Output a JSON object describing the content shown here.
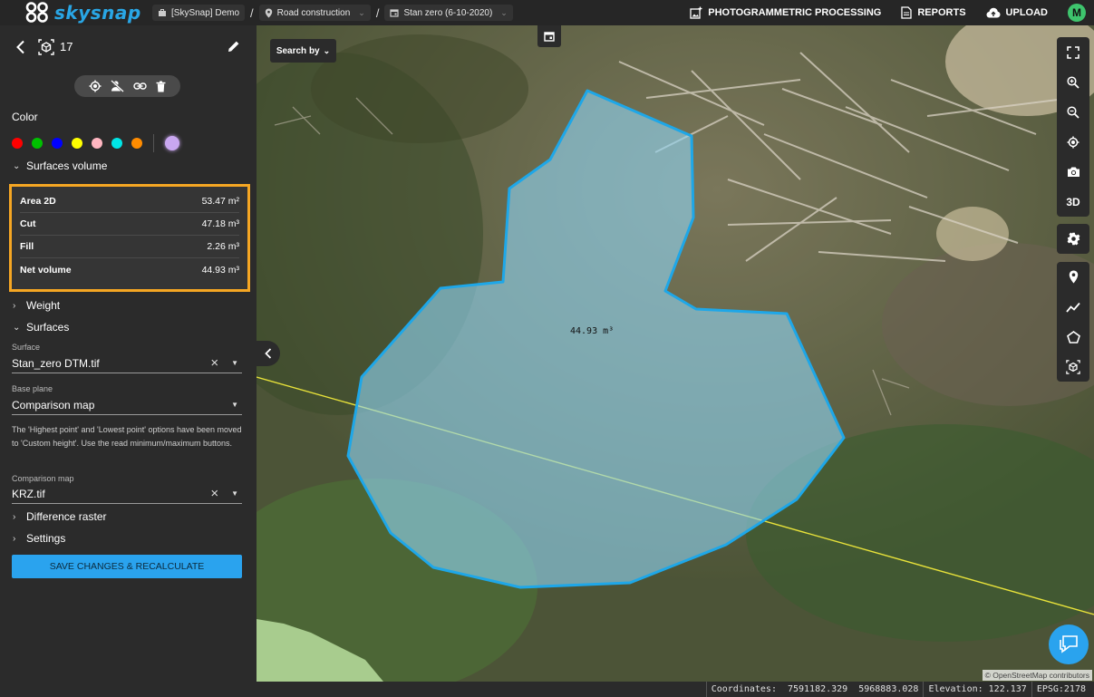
{
  "header": {
    "logo_text": "skysnap",
    "breadcrumbs": [
      {
        "label": "[SkySnap] Demo",
        "icon": "briefcase-icon"
      },
      {
        "label": "Road construction",
        "icon": "location-pin-icon"
      },
      {
        "label": "Stan zero (6-10-2020)",
        "icon": "calendar-icon"
      }
    ],
    "actions": [
      {
        "label": "PHOTOGRAMMETRIC PROCESSING",
        "icon": "image-plus-icon"
      },
      {
        "label": "REPORTS",
        "icon": "document-icon"
      },
      {
        "label": "UPLOAD",
        "icon": "cloud-upload-icon"
      }
    ],
    "avatar": "M"
  },
  "panel": {
    "object_number": "17",
    "color_label": "Color",
    "colors": [
      "#ff0000",
      "#00c000",
      "#0000ff",
      "#ffff00",
      "#ffb6c1",
      "#00e5e5",
      "#ff8c00",
      "#c9a7f0"
    ],
    "surfaces_volume_label": "Surfaces volume",
    "metrics": [
      {
        "label": "Area 2D",
        "value": "53.47 m²"
      },
      {
        "label": "Cut",
        "value": "47.18 m³"
      },
      {
        "label": "Fill",
        "value": "2.26 m³"
      },
      {
        "label": "Net volume",
        "value": "44.93 m³"
      }
    ],
    "weight_label": "Weight",
    "surfaces_label": "Surfaces",
    "surface": {
      "label": "Surface",
      "value": "Stan_zero DTM.tif"
    },
    "base_plane": {
      "label": "Base plane",
      "value": "Comparison map"
    },
    "note": "The 'Highest point' and 'Lowest point' options have been moved to 'Custom height'. Use the read minimum/maximum buttons.",
    "comparison_map": {
      "label": "Comparison map",
      "value": "KRZ.tif"
    },
    "difference_raster_label": "Difference raster",
    "settings_label": "Settings",
    "save_button": "SAVE CHANGES & RECALCULATE"
  },
  "map": {
    "search_by": "Search by",
    "volume_label": "44.93 m³",
    "three_d_label": "3D",
    "attribution": "© OpenStreetMap contributors",
    "polygon_color": "#1ea7e8"
  },
  "status": {
    "coordinates_label": "Coordinates:",
    "coord_x": "7591182.329",
    "coord_y": "5968883.028",
    "elevation_label": "Elevation:",
    "elevation": "122.137",
    "epsg": "EPSG:2178"
  }
}
